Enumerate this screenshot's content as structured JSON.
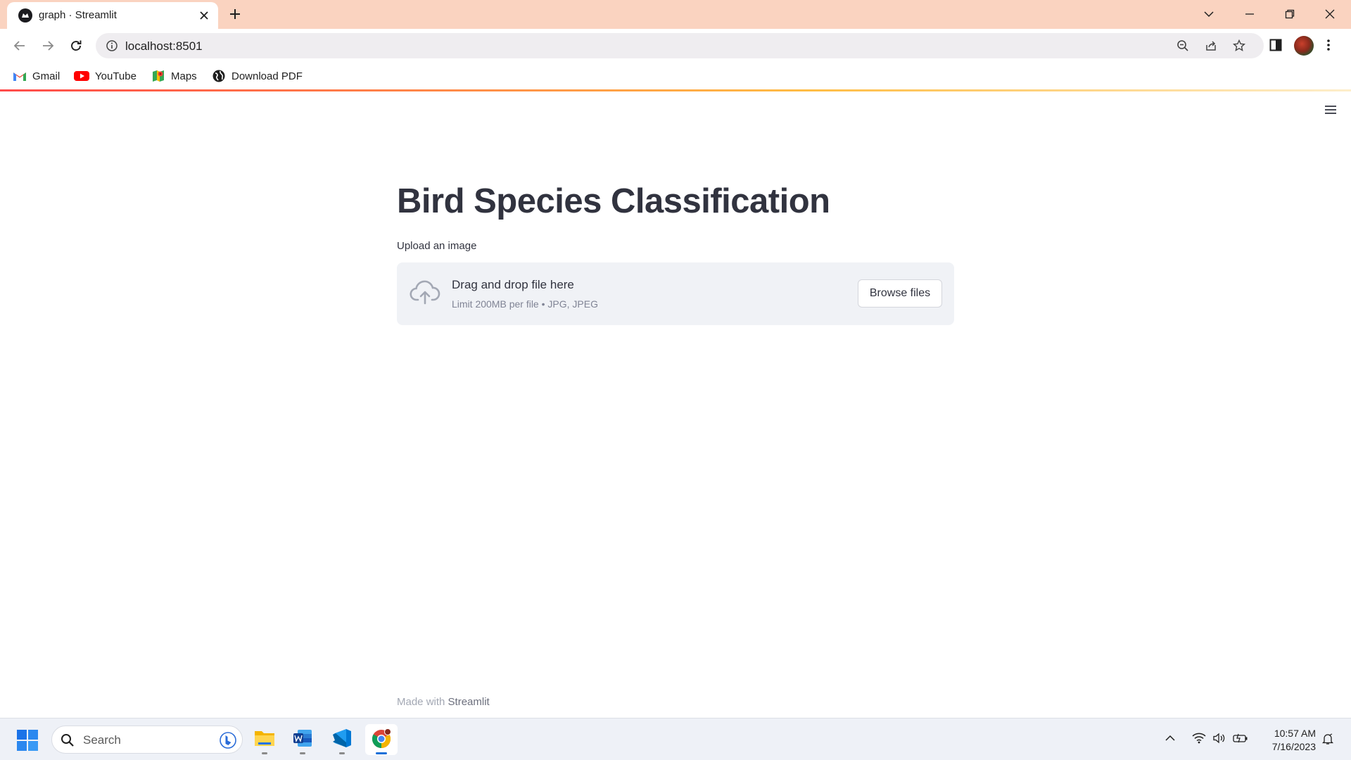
{
  "browser": {
    "tab_title": "graph · Streamlit",
    "url": "localhost:8501",
    "bookmarks": [
      "Gmail",
      "YouTube",
      "Maps",
      "Download PDF"
    ]
  },
  "app": {
    "title": "Bird Species Classification",
    "uploader": {
      "label": "Upload an image",
      "instructions": "Drag and drop file here",
      "limits": "Limit 200MB per file • JPG, JPEG",
      "button_label": "Browse files"
    },
    "footer": {
      "prefix": "Made with",
      "brand": "Streamlit"
    }
  },
  "taskbar": {
    "search_placeholder": "Search",
    "apps": [
      "file-explorer",
      "word",
      "vscode",
      "chrome"
    ],
    "time": "10:57 AM",
    "date": "7/16/2023"
  },
  "colors": {
    "tab_strip": "#fad3c0",
    "streamlit_text": "#31333f",
    "uploader_bg": "#f0f2f6",
    "streamlit_accent": "#ff4b4b"
  }
}
